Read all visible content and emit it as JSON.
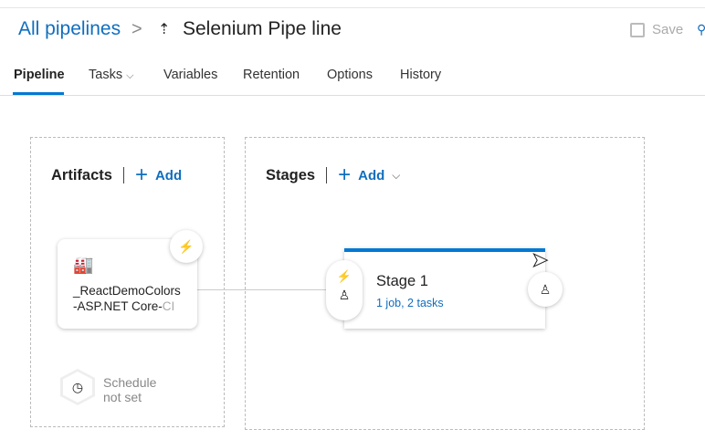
{
  "header": {
    "breadcrumb": "All pipelines",
    "separator": ">",
    "title": "Selenium Pipe line",
    "save_label": "Save"
  },
  "tabs": [
    {
      "label": "Pipeline"
    },
    {
      "label": "Tasks"
    },
    {
      "label": "Variables"
    },
    {
      "label": "Retention"
    },
    {
      "label": "Options"
    },
    {
      "label": "History"
    }
  ],
  "artifacts": {
    "heading": "Artifacts",
    "add_label": "Add",
    "artifact_name_1": "_ReactDemoColors",
    "artifact_name_2": "-ASP.NET Core-",
    "artifact_name_fade": "CI",
    "schedule_1": "Schedule",
    "schedule_2": "not set"
  },
  "stages": {
    "heading": "Stages",
    "add_label": "Add",
    "stage_name": "Stage 1",
    "stage_summary": "1 job, 2 tasks"
  },
  "colors": {
    "accent": "#0078d4",
    "link": "#106ebe"
  }
}
